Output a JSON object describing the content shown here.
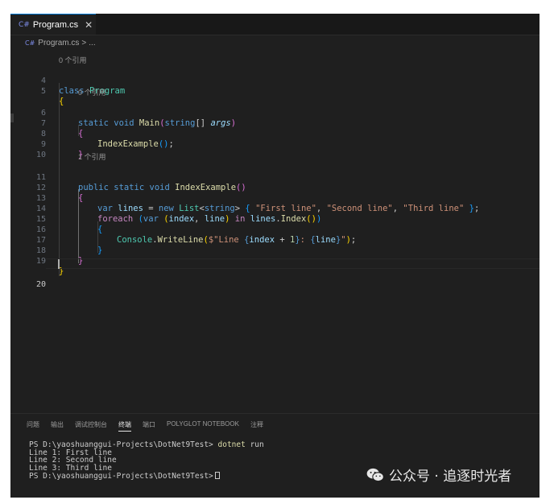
{
  "tab": {
    "icon": "C#",
    "title": "Program.cs",
    "close": "✕"
  },
  "breadcrumb": {
    "icon": "C#",
    "file": "Program.cs",
    "sep": ">",
    "rest": "..."
  },
  "codelens": {
    "zero_refs": "0 个引用",
    "one_ref": "1 个引用"
  },
  "line_numbers": [
    "4",
    "5",
    "6",
    "7",
    "8",
    "9",
    "10",
    "11",
    "12",
    "13",
    "14",
    "15",
    "16",
    "17",
    "18",
    "19",
    "20"
  ],
  "code": {
    "l4": {
      "kw": "class",
      "name": "Program"
    },
    "l5": {
      "brace": "{"
    },
    "l6": {
      "kw1": "static",
      "kw2": "void",
      "name": "Main",
      "open": "(",
      "type": "string",
      "arr": "[]",
      "param": "args",
      "close": ")"
    },
    "l7": {
      "brace": "{"
    },
    "l8": {
      "call": "IndexExample",
      "parens": "()",
      "semi": ";"
    },
    "l9": {
      "brace": "}"
    },
    "l11": {
      "kw1": "public",
      "kw2": "static",
      "kw3": "void",
      "name": "IndexExample",
      "parens": "()"
    },
    "l12": {
      "brace": "{"
    },
    "l13": {
      "kw_var": "var",
      "varname": "lines",
      "eq": "=",
      "kw_new": "new",
      "type": "List",
      "lt": "<",
      "gen": "string",
      "gt": ">",
      "open": "{",
      "s1": "\"First line\"",
      "c1": ",",
      "s2": "\"Second line\"",
      "c2": ",",
      "s3": "\"Third line\"",
      "close": "}",
      "semi": ";"
    },
    "l14": {
      "kw": "foreach",
      "open": "(",
      "kw_var": "var",
      "open2": "(",
      "v1": "index",
      "comma": ",",
      "v2": "line",
      "close2": ")",
      "kw_in": "in",
      "obj": "lines",
      "dot": ".",
      "method": "Index",
      "parens": "()",
      "close": ")"
    },
    "l15": {
      "brace": "{"
    },
    "l16": {
      "cls": "Console",
      "dot": ".",
      "method": "WriteLine",
      "open": "(",
      "sp1": "$\"Line ",
      "ib1": "{",
      "expr_v": "index",
      "expr_op": " + ",
      "expr_n": "1",
      "ib2": "}",
      "sp2": ": ",
      "ib3": "{",
      "expr_v2": "line",
      "ib4": "}",
      "sp3": "\"",
      "close": ")",
      "semi": ";"
    },
    "l17": {
      "brace": "}"
    },
    "l18": {
      "brace": "}"
    },
    "l19": {
      "brace": "}"
    }
  },
  "panel_tabs": [
    "问题",
    "输出",
    "调试控制台",
    "终端",
    "端口",
    "POLYGLOT NOTEBOOK",
    "注释"
  ],
  "terminal": {
    "prompt1": "PS D:\\yaoshuanggui-Projects\\DotNet9Test>",
    "cmd": "dotnet",
    "arg": "run",
    "out1": "Line 1: First line",
    "out2": "Line 2: Second line",
    "out3": "Line 3: Third line",
    "prompt2": "PS D:\\yaoshuanggui-Projects\\DotNet9Test>"
  },
  "watermark": {
    "text": "公众号 · 追逐时光者"
  },
  "colors": {
    "accent": "#0078d4",
    "editor_bg": "#1f1f1f",
    "keyword": "#c586c0",
    "type": "#4ec9b0",
    "string": "#ce9178",
    "function": "#dcdcaa"
  },
  "icons": {
    "tab": "csharp-file-icon",
    "watermark": "wechat-icon"
  }
}
